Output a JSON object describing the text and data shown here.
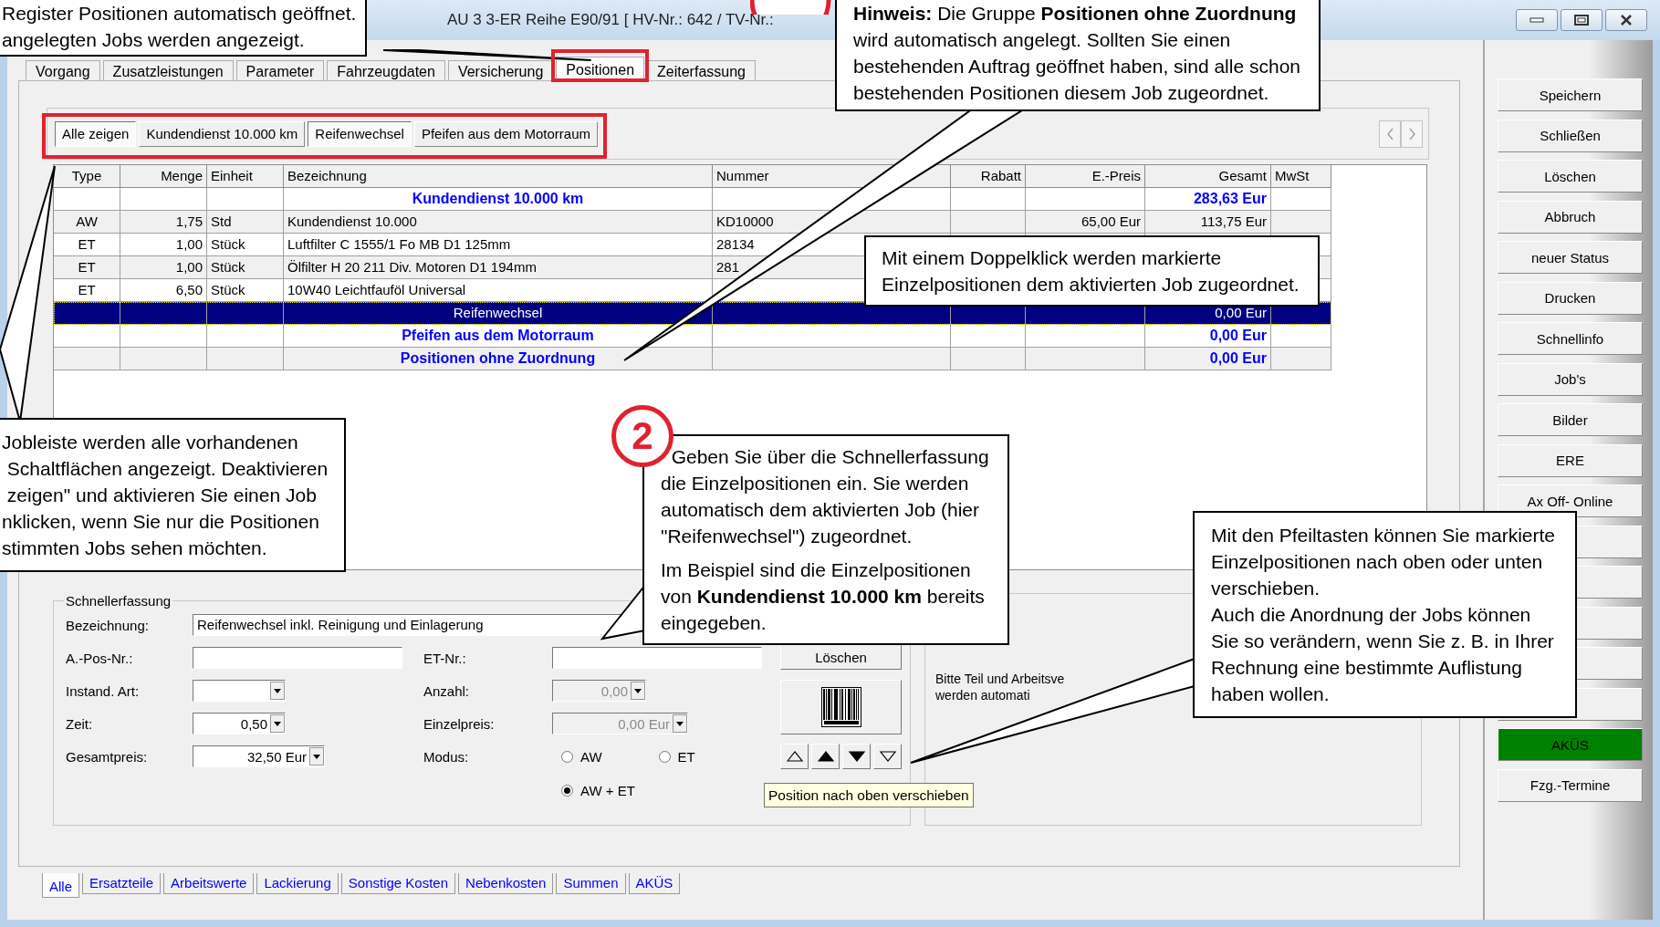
{
  "window": {
    "title": "AU 3 3-ER Reihe E90/91 [ HV-Nr.: 642 / TV-Nr.:"
  },
  "tabs": [
    {
      "label": "Vorgang",
      "selected": false
    },
    {
      "label": "Zusatzleistungen",
      "selected": false
    },
    {
      "label": "Parameter",
      "selected": false
    },
    {
      "label": "Fahrzeugdaten",
      "selected": false
    },
    {
      "label": "Versicherung",
      "selected": false
    },
    {
      "label": "Positionen",
      "selected": true
    },
    {
      "label": "Zeiterfassung",
      "selected": false
    }
  ],
  "job_bar": {
    "buttons": [
      {
        "label": "Alle zeigen",
        "pressed": true
      },
      {
        "label": "Kundendienst 10.000 km",
        "pressed": false
      },
      {
        "label": "Reifenwechsel",
        "pressed": true
      },
      {
        "label": "Pfeifen aus dem Motorraum",
        "pressed": false
      }
    ]
  },
  "table": {
    "columns": [
      "Type",
      "Menge",
      "Einheit",
      "Bezeichnung",
      "Nummer",
      "Rabatt",
      "E.-Preis",
      "Gesamt",
      "MwSt"
    ],
    "rows": [
      {
        "kind": "group",
        "selected": false,
        "bezeichnung": "Kundendienst 10.000 km",
        "gesamt": "283,63 Eur"
      },
      {
        "kind": "item",
        "selected": false,
        "type": "AW",
        "menge": "1,75",
        "einheit": "Std",
        "bezeichnung": "Kundendienst 10.000",
        "nummer": "KD10000",
        "e_preis": "65,00 Eur",
        "gesamt": "113,75 Eur"
      },
      {
        "kind": "item",
        "selected": false,
        "type": "ET",
        "menge": "1,00",
        "einheit": "Stück",
        "bezeichnung": "Luftfilter C 1555/1 Fo MB D1 125mm",
        "nummer": "28134"
      },
      {
        "kind": "item",
        "selected": false,
        "type": "ET",
        "menge": "1,00",
        "einheit": "Stück",
        "bezeichnung": "Ölfilter H 20 211 Div. Motoren D1 194mm",
        "nummer": "281"
      },
      {
        "kind": "item",
        "selected": false,
        "type": "ET",
        "menge": "6,50",
        "einheit": "Stück",
        "bezeichnung": "10W40 Leichtfauföl Universal"
      },
      {
        "kind": "group",
        "selected": true,
        "bezeichnung": "Reifenwechsel",
        "gesamt": "0,00 Eur"
      },
      {
        "kind": "group",
        "selected": false,
        "bezeichnung": "Pfeifen aus dem Motorraum",
        "gesamt": "0,00 Eur"
      },
      {
        "kind": "group",
        "selected": false,
        "bezeichnung": "Positionen ohne Zuordnung",
        "gesamt": "0,00 Eur"
      }
    ]
  },
  "quick_entry": {
    "title": "Schnellerfassung",
    "bezeichnung": {
      "label": "Bezeichnung:",
      "value": "Reifenwechsel inkl. Reinigung und Einlagerung"
    },
    "left_fields": [
      {
        "label": "A.-Pos-Nr.:",
        "kind": "text",
        "disabled": false
      },
      {
        "label": "Instand. Art:",
        "kind": "combo",
        "disabled": false
      },
      {
        "label": "Zeit:",
        "kind": "combo",
        "value": "0,50",
        "disabled": false
      },
      {
        "label": "Gesamtpreis:",
        "kind": "combo",
        "value": "32,50 Eur",
        "disabled": false
      }
    ],
    "right_fields": [
      {
        "label": "ET-Nr.:",
        "kind": "text",
        "disabled": false
      },
      {
        "label": "Anzahl:",
        "kind": "combo",
        "value": "0,00",
        "disabled": true
      },
      {
        "label": "Einzelpreis:",
        "kind": "combo",
        "value": "0,00 Eur",
        "disabled": true
      }
    ],
    "modus": {
      "label": "Modus:",
      "options": [
        {
          "label": "AW",
          "selected": false
        },
        {
          "label": "ET",
          "selected": false
        },
        {
          "label": "AW + ET",
          "selected": true
        }
      ]
    },
    "delete_button": "Löschen",
    "tooltip": "Position nach oben verschieben"
  },
  "info_panel": {
    "text": "Bitte Teil und Arbeitsve\nwerden automati"
  },
  "bottom_tabs": [
    {
      "label": "Alle",
      "selected": true
    },
    {
      "label": "Ersatzteile",
      "selected": false
    },
    {
      "label": "Arbeitswerte",
      "selected": false
    },
    {
      "label": "Lackierung",
      "selected": false
    },
    {
      "label": "Sonstige Kosten",
      "selected": false
    },
    {
      "label": "Nebenkosten",
      "selected": false
    },
    {
      "label": "Summen",
      "selected": false
    },
    {
      "label": "AKÜS",
      "selected": false
    }
  ],
  "side_buttons": [
    {
      "kind": "normal",
      "label": "Speichern"
    },
    {
      "kind": "normal",
      "label": "Schließen"
    },
    {
      "kind": "normal",
      "label": "Löschen"
    },
    {
      "kind": "normal",
      "label": "Abbruch"
    },
    {
      "kind": "normal",
      "label": "neuer Status"
    },
    {
      "kind": "normal",
      "label": "Drucken"
    },
    {
      "kind": "normal",
      "label": "Schnellinfo"
    },
    {
      "kind": "normal",
      "label": "Job's"
    },
    {
      "kind": "normal",
      "label": "Bilder"
    },
    {
      "kind": "normal",
      "label": "ERE"
    },
    {
      "kind": "normal",
      "label": "Ax Off- Online"
    },
    {
      "kind": "empty"
    },
    {
      "kind": "empty"
    },
    {
      "kind": "empty"
    },
    {
      "kind": "empty"
    },
    {
      "kind": "empty"
    },
    {
      "kind": "alert",
      "label": "AKÜS"
    },
    {
      "kind": "normal",
      "label": "Fzg.-Termine"
    }
  ],
  "callouts": [
    {
      "kind": "plain",
      "paragraphs": [
        "Register Positionen automatisch geöffnet.\nangelegten Jobs werden angezeigt."
      ]
    },
    {
      "kind": "plain",
      "paragraphs": [
        "**Hinweis:** Die Gruppe **Positionen ohne Zuordnung**\nwird automatisch angelegt. Sollten Sie einen\nbestehenden Auftrag geöffnet haben, sind alle schon\nbestehenden Positionen diesem Job zugeordnet."
      ]
    },
    {
      "kind": "plain",
      "paragraphs": [
        "Mit einem Doppelklick werden markierte\nEinzelpositionen dem aktivierten Job zugeordnet."
      ]
    },
    {
      "kind": "plain",
      "paragraphs": [
        "Jobleiste werden alle vorhandenen\n Schaltflächen angezeigt. Deaktivieren\n zeigen\" und aktivieren Sie einen Job\nnklicken, wenn Sie nur die Positionen\nstimmten Jobs sehen möchten."
      ]
    },
    {
      "kind": "step",
      "step": "2",
      "paragraphs": [
        "  Geben Sie über die Schnellerfassung\ndie Einzelpositionen ein. Sie werden\nautomatisch dem aktivierten Job (hier\n\"Reifenwechsel\") zugeordnet.",
        "Im Beispiel sind die Einzelpositionen\nvon **Kundendienst 10.000 km** bereits\neingegeben."
      ]
    },
    {
      "kind": "plain",
      "paragraphs": [
        "Mit den Pfeiltasten können Sie markierte\nEinzelpositionen nach oben oder unten\nverschieben.\nAuch die Anordnung der Jobs können\nSie so verändern, wenn Sie z. B. in Ihrer\nRechnung eine bestimmte Auflistung\nhaben wollen."
      ]
    }
  ]
}
